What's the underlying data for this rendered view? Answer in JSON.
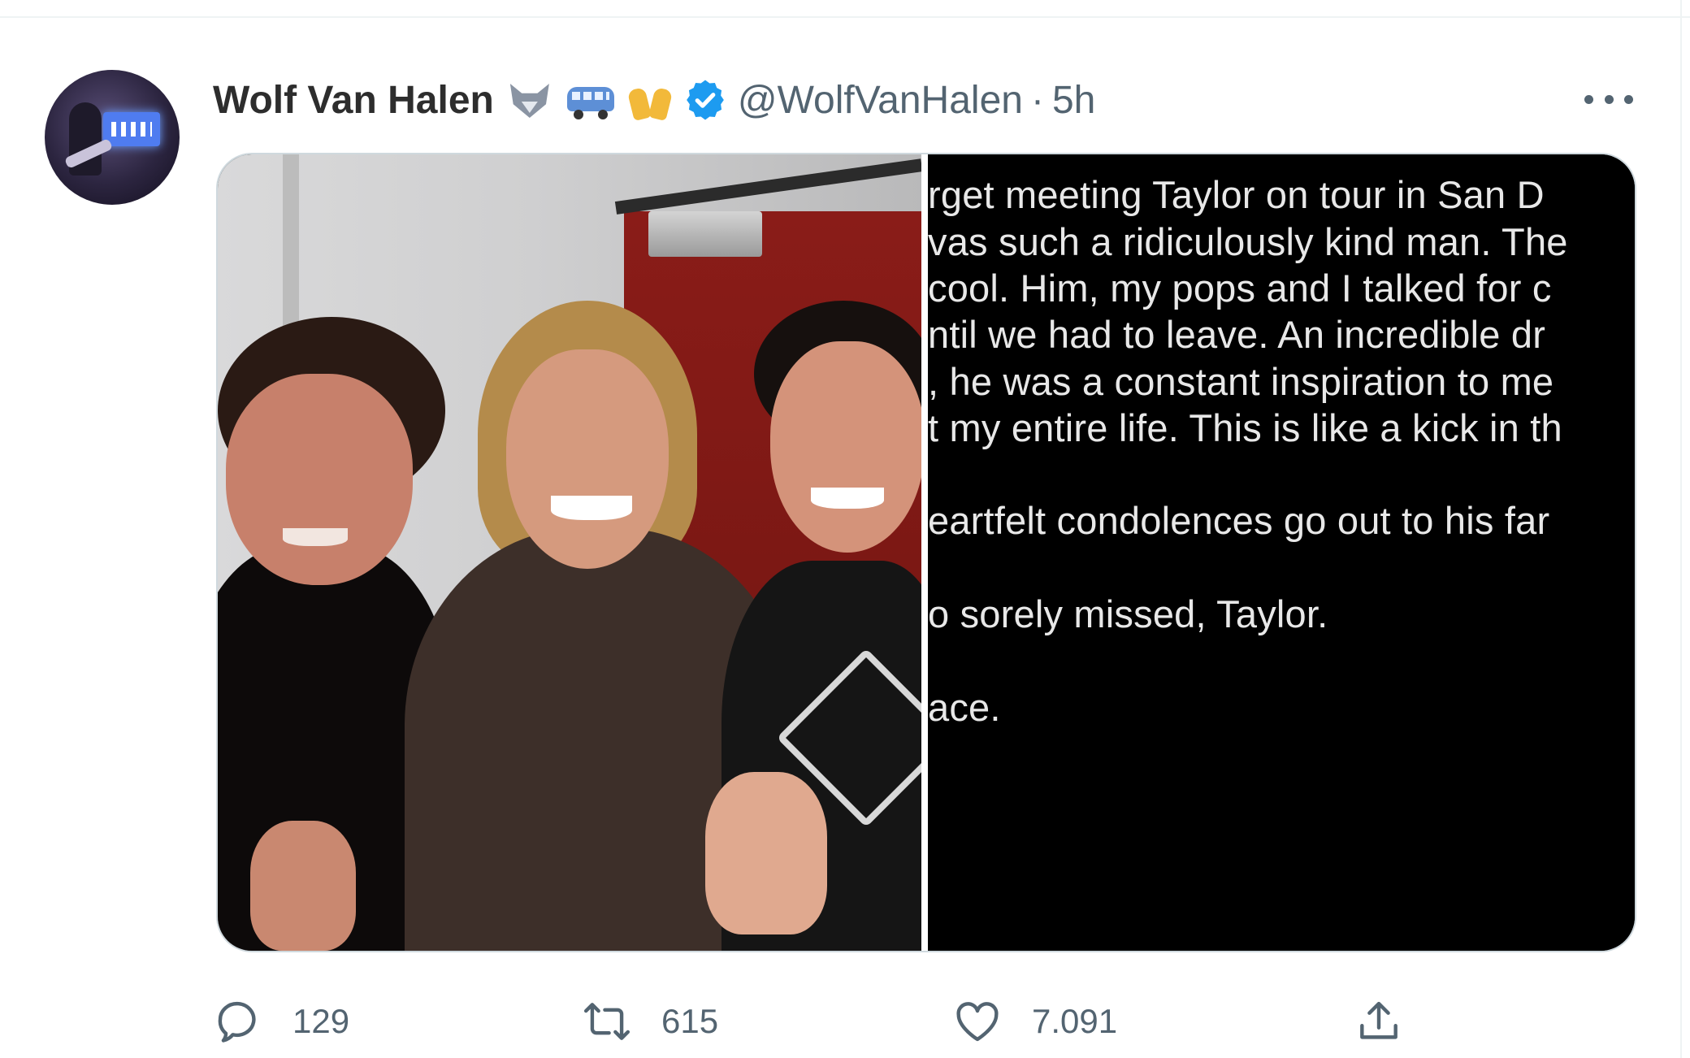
{
  "tweet": {
    "display_name": "Wolf Van Halen",
    "emojis": [
      "wolf-icon",
      "van-icon",
      "raising-hands-icon"
    ],
    "verified": true,
    "handle": "@WolfVanHalen",
    "separator": "·",
    "time": "5h",
    "media": {
      "left_image": "photo",
      "right_image_lines": [
        "rget meeting Taylor on tour in San D",
        "vas such a ridiculously kind man. The",
        "cool. Him, my pops and I talked for c",
        "ntil we had to leave. An incredible dr",
        ", he was a constant inspiration to me",
        "t my entire life. This is like a kick in th",
        "eartfelt condolences go out to his far",
        "o sorely missed, Taylor.",
        "ace."
      ]
    },
    "actions": {
      "reply_count": "129",
      "retweet_count": "615",
      "like_count": "7.091"
    }
  },
  "colors": {
    "name": "#2d2d2d",
    "secondary": "#536471",
    "verified": "#1d9bf0",
    "text_panel_bg": "#000000",
    "text_panel_fg": "#e8e8e8"
  }
}
